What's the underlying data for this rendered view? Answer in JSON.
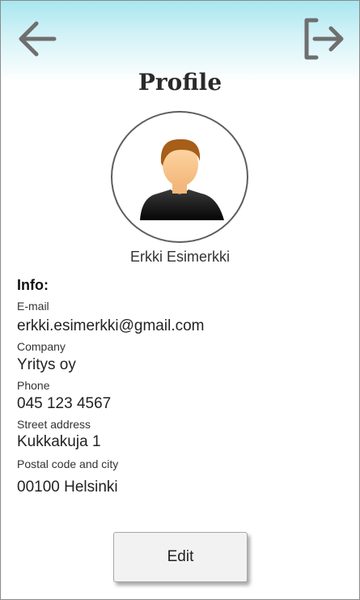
{
  "header": {
    "back_icon": "arrow-left-icon",
    "logout_icon": "logout-icon",
    "title": "Profile"
  },
  "profile": {
    "avatar_icon": "user-avatar-icon",
    "name": "Erkki Esimerkki"
  },
  "info": {
    "heading": "Info:",
    "fields": [
      {
        "label": "E-mail",
        "value": "erkki.esimerkki@gmail.com"
      },
      {
        "label": "Company",
        "value": "Yritys oy"
      },
      {
        "label": "Phone",
        "value": "045 123 4567"
      },
      {
        "label": "Street address",
        "value": "Kukkakuja 1"
      },
      {
        "label": "Postal code and city",
        "value": "00100 Helsinki"
      }
    ]
  },
  "actions": {
    "edit_label": "Edit"
  },
  "colors": {
    "header_top": "#a9e6f0",
    "icon_gray": "#6f6f6f",
    "border": "#8a8a8a"
  }
}
